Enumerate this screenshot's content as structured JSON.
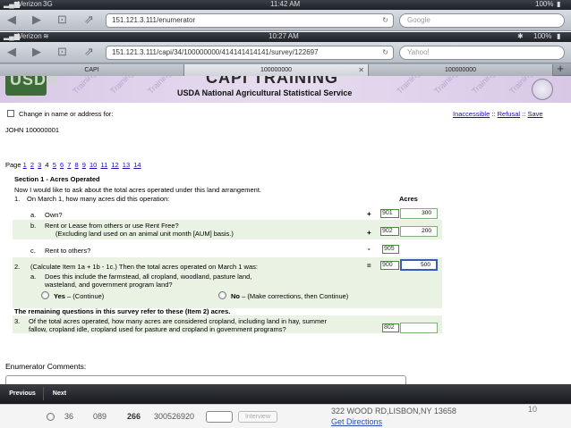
{
  "bg_browser": {
    "carrier": "Verizon",
    "network": "3G",
    "time": "11:42 AM",
    "battery": "100%",
    "url": "151.121.3.111/enumerator",
    "search_placeholder": "Google"
  },
  "fg_browser": {
    "carrier": "Verizon",
    "time": "10:27 AM",
    "battery": "100%",
    "url": "151.121.3.111/capi/34/100000000/414141414141/survey/122697",
    "search_placeholder": "Yahoo!",
    "tabs": [
      {
        "label": "CAPI"
      },
      {
        "label": "100000000"
      },
      {
        "label": "100000000"
      }
    ]
  },
  "header": {
    "logo_text": "USDA",
    "top_title": "CAPI TRAINING",
    "title": "USDA National Agricultural Statistical Service",
    "watermark": "Training"
  },
  "top": {
    "change_label": "Change in name or address for:",
    "links": [
      "Inaccessible",
      "Refusal",
      "Save"
    ],
    "separator": "::",
    "respondent": "JOHN  100000001"
  },
  "pagination": {
    "label": "Page",
    "current": "4",
    "pages": [
      "1",
      "2",
      "3",
      "4",
      "5",
      "6",
      "7",
      "8",
      "9",
      "10",
      "11",
      "12",
      "13",
      "14"
    ]
  },
  "section": {
    "title": "Section 1  - Acres Operated",
    "intro": "Now I would like to ask about the total acres operated under this land arrangement.",
    "q1_num": "1.",
    "q1_text": "On March 1, how many acres did this operation:",
    "acres_header": "Acres",
    "items": [
      {
        "letter": "a.",
        "text": "Own?",
        "text2": "",
        "op": "+",
        "code": "901",
        "value": "300"
      },
      {
        "letter": "b.",
        "text": "Rent or Lease from others or use Rent Free?",
        "text2": "(Excluding land used on an animal unit month [AUM] basis.)",
        "op": "+",
        "code": "902",
        "value": "200"
      },
      {
        "letter": "c.",
        "text": "Rent to others?",
        "text2": "",
        "op": "-",
        "code": "905",
        "value": ""
      }
    ],
    "q2_num": "2.",
    "q2_text": "(Calculate Item 1a + 1b - 1c.)  Then the total acres operated on March 1 was:",
    "q2_op": "=",
    "q2_code": "900",
    "q2_value": "500",
    "q2a_letter": "a.",
    "q2a_text": "Does this include the farmstead, all cropland, woodland, pasture land,",
    "q2a_text2": "wasteland, and government program land?",
    "yes_label": "Yes",
    "yes_hint": " – (Continue)",
    "no_label": "No",
    "no_hint": " – (Make corrections, then Continue)",
    "remaining_text": "The remaining questions in this survey refer to these (Item 2) acres.",
    "q3_num": "3.",
    "q3_text": "Of the total acres operated, how many acres are considered cropland, including land in hay, summer",
    "q3_text2": "fallow, cropland idle, cropland used for pasture and cropland in government programs?",
    "q3_code": "802",
    "q3_value": ""
  },
  "comments_label": "Enumerator Comments:",
  "bottom_nav": {
    "previous": "Previous",
    "next": "Next"
  },
  "bottom_panel": {
    "col1": "36",
    "col2": "089",
    "col3": "266",
    "col4": "300526920",
    "button": "Interview",
    "address": "322 WOOD RD,LISBON,NY 13658",
    "directions": "Get Directions",
    "page_number": "10"
  }
}
